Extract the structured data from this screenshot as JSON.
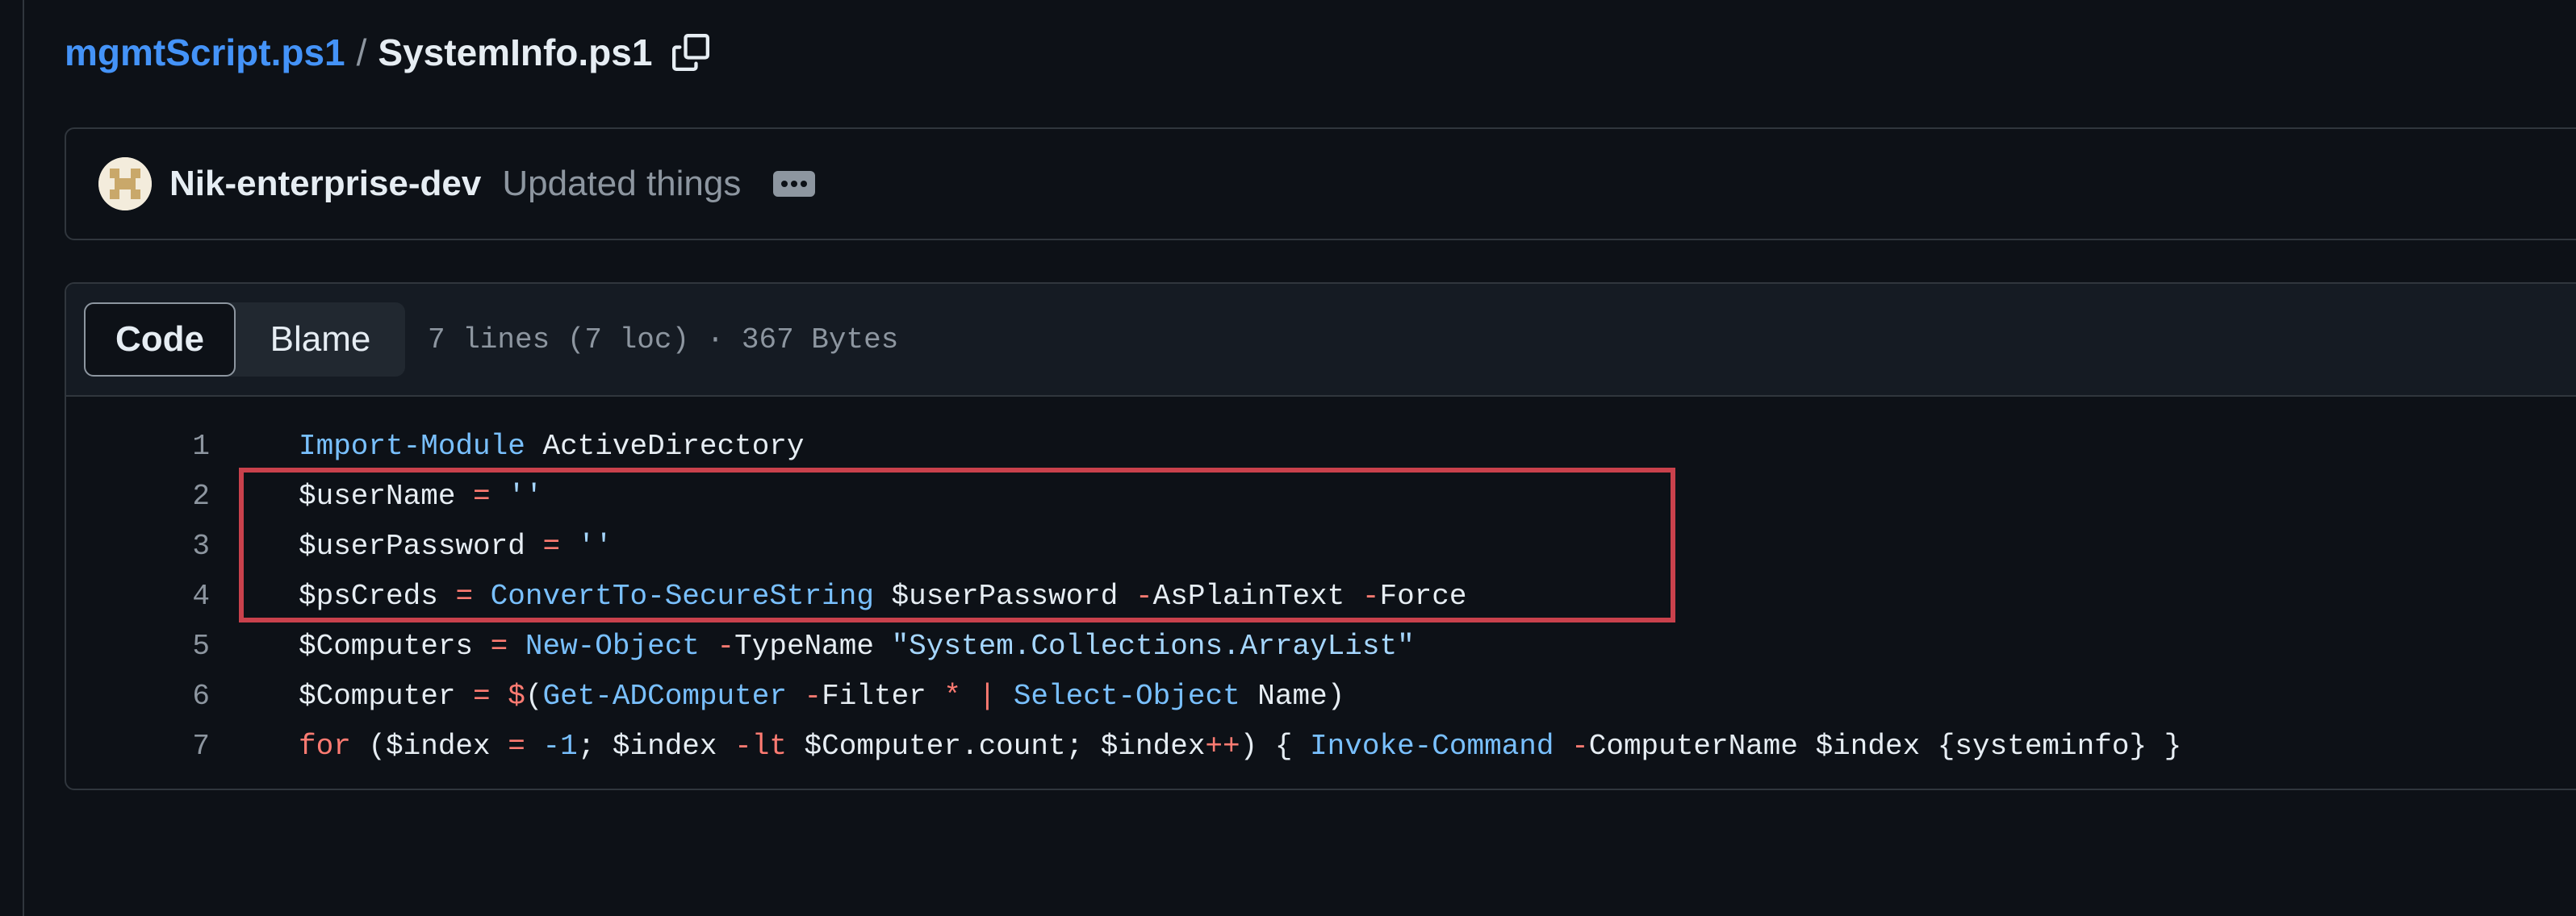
{
  "breadcrumb": {
    "parent": "mgmtScript.ps1",
    "separator": "/",
    "current": "SystemInfo.ps1"
  },
  "commit": {
    "author": "Nik-enterprise-dev",
    "message": "Updated things"
  },
  "file_header": {
    "tabs": [
      "Code",
      "Blame"
    ],
    "active_tab": "Code",
    "meta": "7 lines (7 loc) · 367 Bytes"
  },
  "code": {
    "language": "PowerShell",
    "highlighted_lines": [
      2,
      4
    ],
    "highlight_color": "#c9414c",
    "lines": [
      {
        "number": "1",
        "tokens": [
          {
            "t": "Import-Module",
            "c": "t-cmd"
          },
          {
            "t": " ActiveDirectory",
            "c": "t-plain"
          }
        ]
      },
      {
        "number": "2",
        "tokens": [
          {
            "t": "$userName",
            "c": "t-var"
          },
          {
            "t": " ",
            "c": "t-plain"
          },
          {
            "t": "=",
            "c": "t-op"
          },
          {
            "t": " ",
            "c": "t-plain"
          },
          {
            "t": "''",
            "c": "t-str"
          }
        ]
      },
      {
        "number": "3",
        "tokens": [
          {
            "t": "$userPassword",
            "c": "t-var"
          },
          {
            "t": " ",
            "c": "t-plain"
          },
          {
            "t": "=",
            "c": "t-op"
          },
          {
            "t": " ",
            "c": "t-plain"
          },
          {
            "t": "''",
            "c": "t-str"
          }
        ]
      },
      {
        "number": "4",
        "tokens": [
          {
            "t": "$psCreds",
            "c": "t-var"
          },
          {
            "t": " ",
            "c": "t-plain"
          },
          {
            "t": "=",
            "c": "t-op"
          },
          {
            "t": " ",
            "c": "t-plain"
          },
          {
            "t": "ConvertTo-SecureString",
            "c": "t-cmd"
          },
          {
            "t": " $userPassword ",
            "c": "t-var"
          },
          {
            "t": "-",
            "c": "t-op"
          },
          {
            "t": "AsPlainText ",
            "c": "t-plain"
          },
          {
            "t": "-",
            "c": "t-op"
          },
          {
            "t": "Force",
            "c": "t-plain"
          }
        ]
      },
      {
        "number": "5",
        "tokens": [
          {
            "t": "$Computers",
            "c": "t-var"
          },
          {
            "t": " ",
            "c": "t-plain"
          },
          {
            "t": "=",
            "c": "t-op"
          },
          {
            "t": " ",
            "c": "t-plain"
          },
          {
            "t": "New-Object",
            "c": "t-cmd"
          },
          {
            "t": " ",
            "c": "t-plain"
          },
          {
            "t": "-",
            "c": "t-op"
          },
          {
            "t": "TypeName ",
            "c": "t-plain"
          },
          {
            "t": "\"System.Collections.ArrayList\"",
            "c": "t-str"
          }
        ]
      },
      {
        "number": "6",
        "tokens": [
          {
            "t": "$Computer",
            "c": "t-var"
          },
          {
            "t": " ",
            "c": "t-plain"
          },
          {
            "t": "=",
            "c": "t-op"
          },
          {
            "t": " ",
            "c": "t-plain"
          },
          {
            "t": "$",
            "c": "t-op"
          },
          {
            "t": "(",
            "c": "t-plain"
          },
          {
            "t": "Get-ADComputer",
            "c": "t-cmd"
          },
          {
            "t": " ",
            "c": "t-plain"
          },
          {
            "t": "-",
            "c": "t-op"
          },
          {
            "t": "Filter ",
            "c": "t-plain"
          },
          {
            "t": "*",
            "c": "t-op"
          },
          {
            "t": " ",
            "c": "t-plain"
          },
          {
            "t": "|",
            "c": "t-op"
          },
          {
            "t": " ",
            "c": "t-plain"
          },
          {
            "t": "Select-Object",
            "c": "t-cmd"
          },
          {
            "t": " Name)",
            "c": "t-plain"
          }
        ]
      },
      {
        "number": "7",
        "tokens": [
          {
            "t": "for",
            "c": "t-kw"
          },
          {
            "t": " ($index ",
            "c": "t-plain"
          },
          {
            "t": "=",
            "c": "t-op"
          },
          {
            "t": " ",
            "c": "t-plain"
          },
          {
            "t": "-1",
            "c": "t-num"
          },
          {
            "t": "; $index ",
            "c": "t-plain"
          },
          {
            "t": "-lt",
            "c": "t-op"
          },
          {
            "t": " $Computer.count; $index",
            "c": "t-plain"
          },
          {
            "t": "++",
            "c": "t-op"
          },
          {
            "t": ") { ",
            "c": "t-plain"
          },
          {
            "t": "Invoke-Command",
            "c": "t-cmd"
          },
          {
            "t": " ",
            "c": "t-plain"
          },
          {
            "t": "-",
            "c": "t-op"
          },
          {
            "t": "ComputerName $index {systeminfo} }",
            "c": "t-plain"
          }
        ]
      }
    ]
  },
  "icons": {
    "copy_path": "copy-icon",
    "avatar": "avatar",
    "ellipsis": "ellipsis-icon"
  }
}
